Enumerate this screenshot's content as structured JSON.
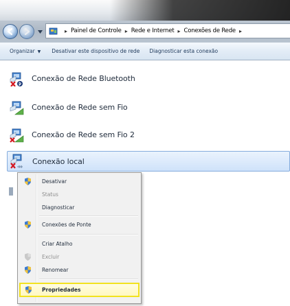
{
  "address": {
    "breadcrumbs": [
      "Painel de Controle",
      "Rede e Internet",
      "Conexões de Rede"
    ],
    "separator": "▸"
  },
  "toolbar": {
    "organize": "Organizar",
    "organize_caret": "▼",
    "disable_device": "Desativar este dispositivo de rede",
    "diagnose_connection": "Diagnosticar esta conexão"
  },
  "connections": [
    {
      "label": "Conexão de Rede Bluetooth",
      "icon": "bluetooth-network-icon",
      "selected": false
    },
    {
      "label": "Conexão de Rede sem Fio",
      "icon": "wireless-network-icon",
      "selected": false
    },
    {
      "label": "Conexão de Rede sem Fio 2",
      "icon": "wireless-network-disconnected-icon",
      "selected": false
    },
    {
      "label": "Conexão local",
      "icon": "lan-network-disconnected-icon",
      "selected": true
    }
  ],
  "context_menu": {
    "items": [
      {
        "label": "Desativar",
        "icon": "shield-icon",
        "bold": false,
        "disabled": false
      },
      {
        "label": "Status",
        "icon": "",
        "bold": false,
        "disabled": true
      },
      {
        "label": "Diagnosticar",
        "icon": "",
        "bold": false,
        "disabled": false
      },
      {
        "label": "Conexões de Ponte",
        "icon": "shield-icon",
        "bold": false,
        "disabled": false
      },
      {
        "label": "Criar Atalho",
        "icon": "",
        "bold": false,
        "disabled": false
      },
      {
        "label": "Excluir",
        "icon": "shield-icon",
        "bold": false,
        "disabled": true
      },
      {
        "label": "Renomear",
        "icon": "shield-icon",
        "bold": false,
        "disabled": false
      },
      {
        "label": "Propriedades",
        "icon": "shield-icon",
        "bold": true,
        "disabled": false,
        "highlighted": true
      }
    ]
  },
  "colors": {
    "selection_border": "#84acdd",
    "highlight_border": "#f2e21f",
    "link_text": "#1e395b",
    "error_red": "#d4171f"
  }
}
